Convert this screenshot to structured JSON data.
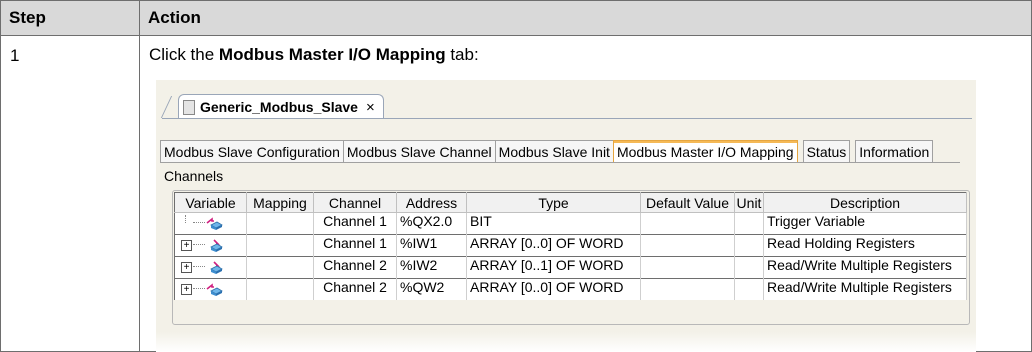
{
  "table": {
    "headers": {
      "step": "Step",
      "action": "Action"
    },
    "row": {
      "step": "1",
      "instruction": {
        "pre": "Click the ",
        "bold": "Modbus Master I/O Mapping",
        "post": " tab:"
      }
    }
  },
  "screenshot": {
    "document_tab": {
      "title": "Generic_Modbus_Slave",
      "close": "×"
    },
    "tabs": [
      "Modbus Slave Configuration",
      "Modbus Slave Channel",
      "Modbus Slave Init",
      "Modbus Master I/O Mapping",
      "Status",
      "Information"
    ],
    "active_tab": "Modbus Master I/O Mapping",
    "section_label": "Channels",
    "columns": [
      "Variable",
      "Mapping",
      "Channel",
      "Address",
      "Type",
      "Default Value",
      "Unit",
      "Description"
    ],
    "rows": [
      {
        "expand": "",
        "icon": "output-variable-icon",
        "mapping": "",
        "channel": "Channel 1",
        "address": "%QX2.0",
        "type": "BIT",
        "default": "",
        "unit": "",
        "description": "Trigger Variable"
      },
      {
        "expand": "+",
        "icon": "input-variable-icon",
        "mapping": "",
        "channel": "Channel 1",
        "address": "%IW1",
        "type": "ARRAY [0..0] OF WORD",
        "default": "",
        "unit": "",
        "description": "Read Holding Registers"
      },
      {
        "expand": "+",
        "icon": "input-variable-icon",
        "mapping": "",
        "channel": "Channel 2",
        "address": "%IW2",
        "type": "ARRAY [0..1] OF WORD",
        "default": "",
        "unit": "",
        "description": "Read/Write Multiple Registers"
      },
      {
        "expand": "+",
        "icon": "output-variable-icon",
        "mapping": "",
        "channel": "Channel 2",
        "address": "%QW2",
        "type": "ARRAY [0..0] OF WORD",
        "default": "",
        "unit": "",
        "description": "Read/Write Multiple Registers"
      }
    ],
    "colors": {
      "active_tab_border": "#e6a640",
      "grid_border": "#c0c0c0",
      "header_bg": "#d9d9d9"
    }
  }
}
